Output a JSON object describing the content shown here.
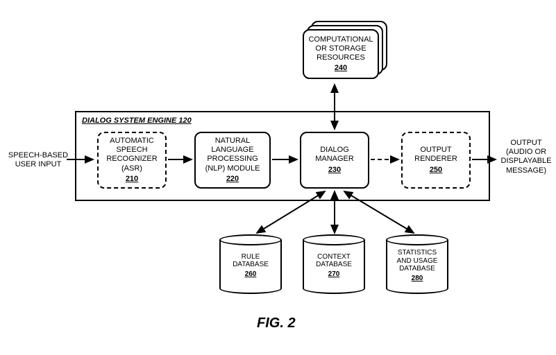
{
  "figure_label": "FIG. 2",
  "input_label": "SPEECH-BASED\nUSER INPUT",
  "output_label": "OUTPUT\n(AUDIO OR\nDISPLAYABLE\nMESSAGE)",
  "engine": {
    "title": "DIALOG SYSTEM ENGINE 120"
  },
  "resources": {
    "title": "COMPUTATIONAL\nOR STORAGE\nRESOURCES",
    "num": "240"
  },
  "asr": {
    "title": "AUTOMATIC\nSPEECH\nRECOGNIZER\n(ASR)",
    "num": "210"
  },
  "nlp": {
    "title": "NATURAL\nLANGUAGE\nPROCESSING\n(NLP) MODULE",
    "num": "220"
  },
  "dialog": {
    "title": "DIALOG\nMANAGER",
    "num": "230"
  },
  "renderer": {
    "title": "OUTPUT\nRENDERER",
    "num": "250"
  },
  "rule_db": {
    "title": "RULE\nDATABASE",
    "num": "260"
  },
  "context_db": {
    "title": "CONTEXT\nDATABASE",
    "num": "270"
  },
  "stats_db": {
    "title": "STATISTICS\nAND USAGE\nDATABASE",
    "num": "280"
  }
}
